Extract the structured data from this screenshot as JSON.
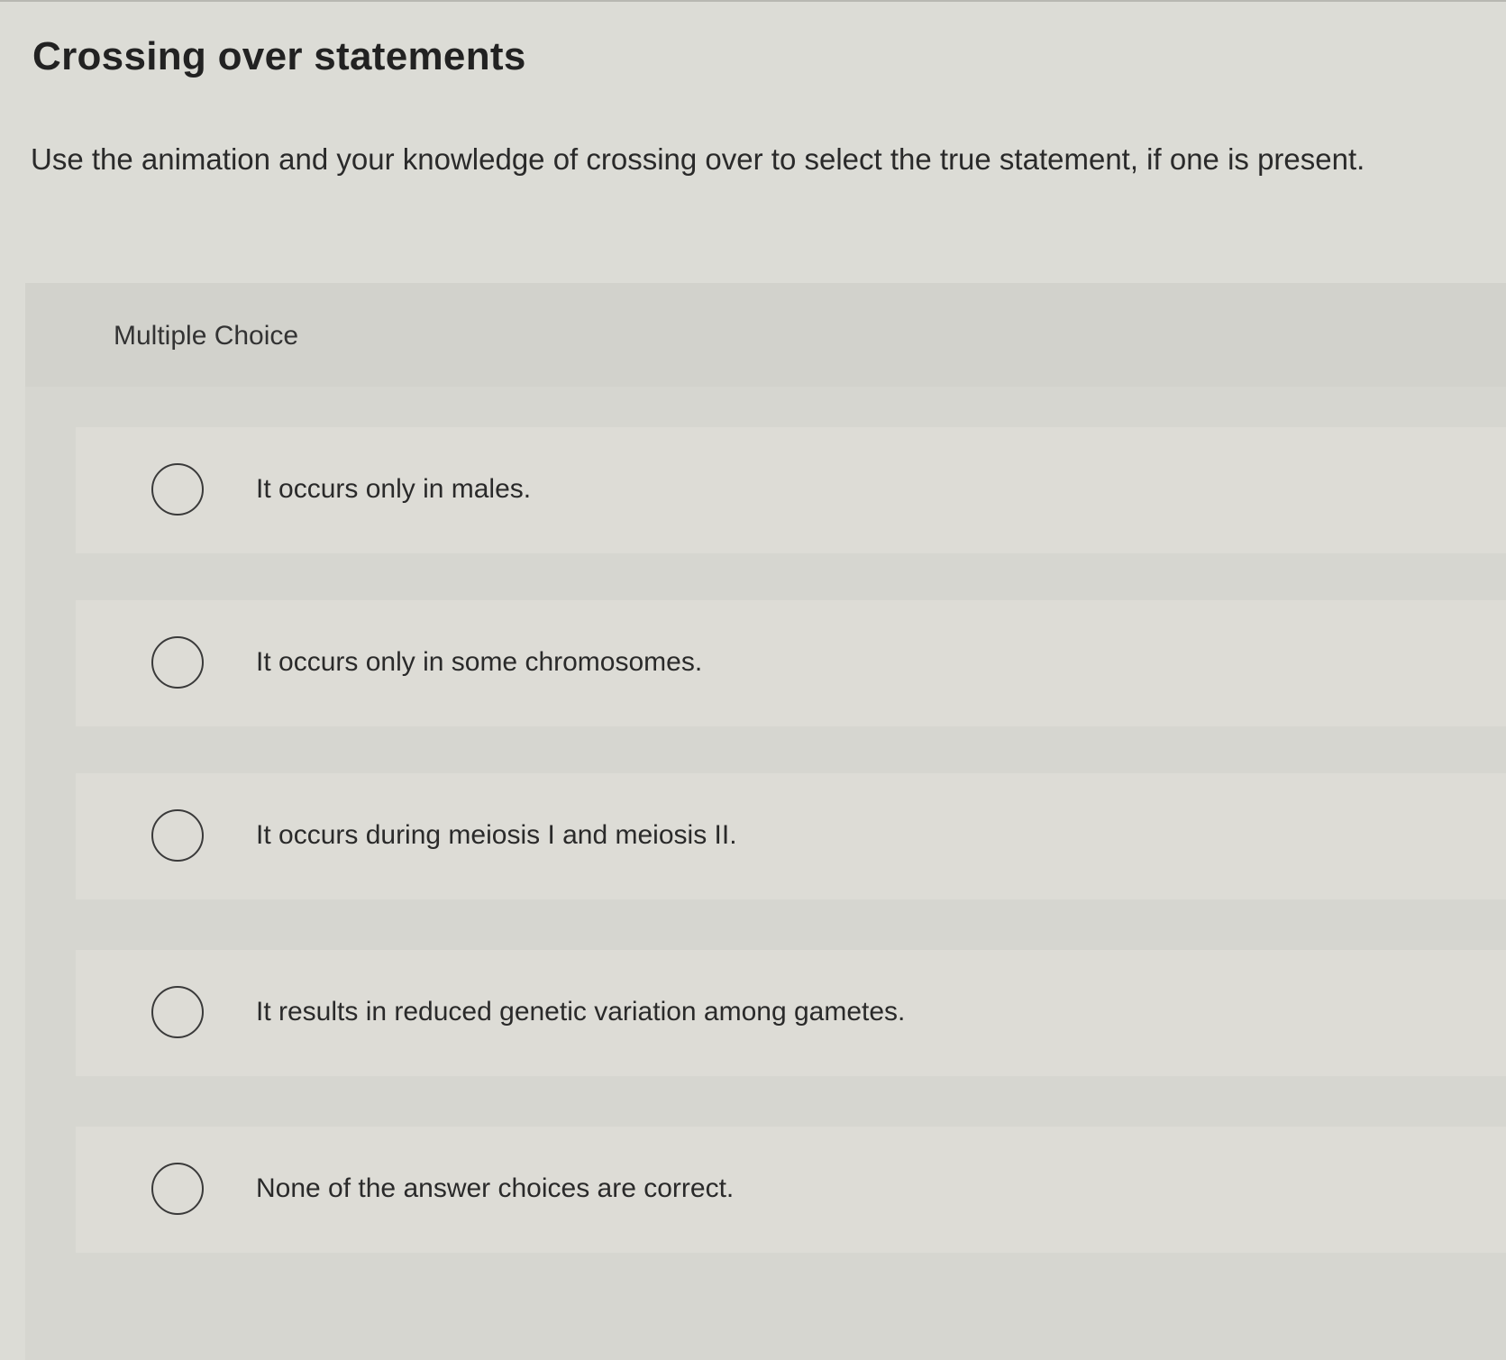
{
  "page": {
    "title": "Crossing over statements",
    "prompt": "Use the animation and your knowledge of crossing over to select the true statement, if one is present."
  },
  "question": {
    "type_label": "Multiple Choice",
    "options": [
      {
        "label": "It occurs only in males.",
        "selected": false
      },
      {
        "label": "It occurs only in some chromosomes.",
        "selected": false
      },
      {
        "label": "It occurs during meiosis I and meiosis II.",
        "selected": false
      },
      {
        "label": "It results in reduced genetic variation among gametes.",
        "selected": false
      },
      {
        "label": "None of the answer choices are correct.",
        "selected": false
      }
    ]
  }
}
